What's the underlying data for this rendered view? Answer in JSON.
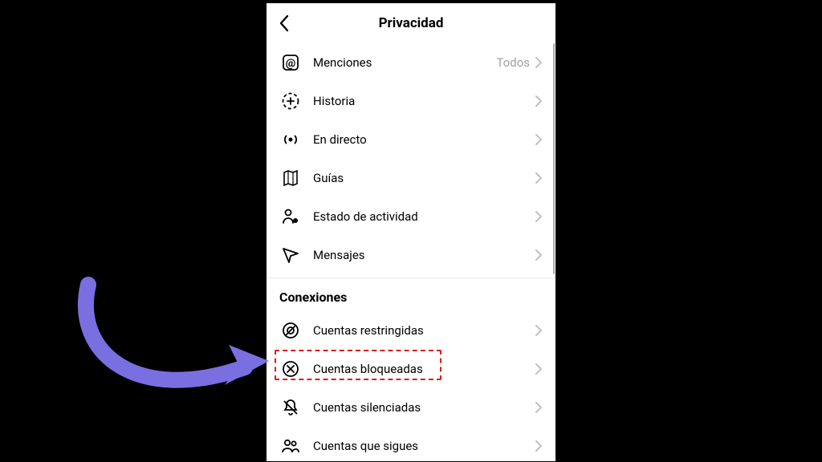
{
  "header": {
    "title": "Privacidad"
  },
  "section1": {
    "rows": [
      {
        "label": "Menciones",
        "value": "Todos"
      },
      {
        "label": "Historia"
      },
      {
        "label": "En directo"
      },
      {
        "label": "Guías"
      },
      {
        "label": "Estado de actividad"
      },
      {
        "label": "Mensajes"
      }
    ]
  },
  "section2": {
    "title": "Conexiones",
    "rows": [
      {
        "label": "Cuentas restringidas"
      },
      {
        "label": "Cuentas bloqueadas"
      },
      {
        "label": "Cuentas silenciadas"
      },
      {
        "label": "Cuentas que sigues"
      }
    ]
  },
  "annotation": {
    "arrow_color": "#7a6fe0",
    "highlight_color": "#d92020"
  }
}
